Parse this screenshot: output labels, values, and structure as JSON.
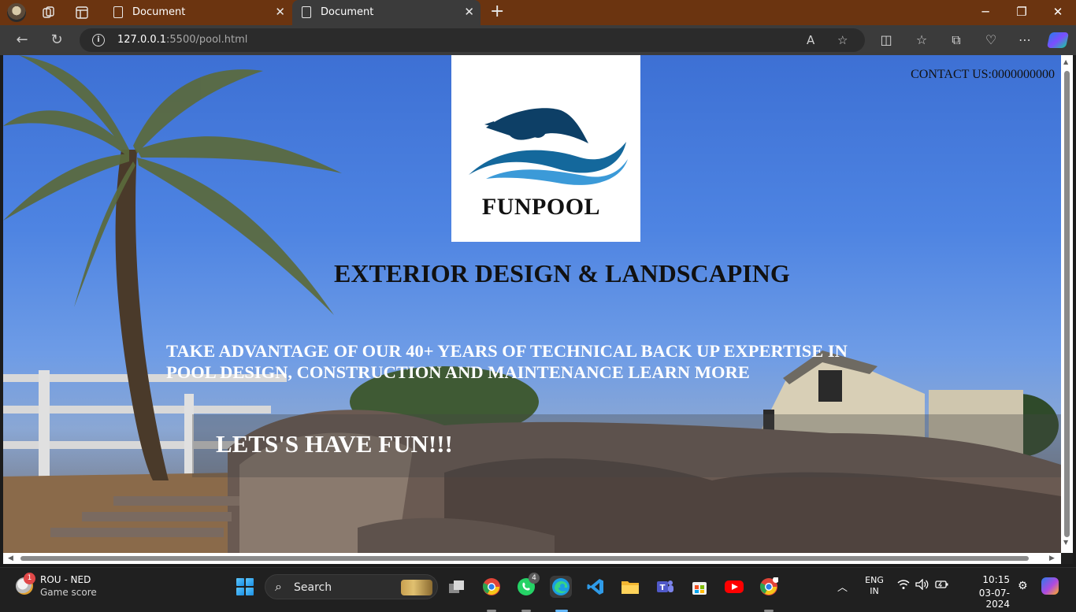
{
  "browser": {
    "tabs": [
      {
        "title": "Document",
        "active": false
      },
      {
        "title": "Document",
        "active": true
      }
    ],
    "url_host": "127.0.0.1",
    "url_rest": ":5500/pool.html",
    "colors": {
      "titlebar": "#6b3410",
      "toolbar": "#3b3b3b"
    }
  },
  "page": {
    "logo_text": "FUNPOOL",
    "contact": "CONTACT US:0000000000",
    "heading": "EXTERIOR DESIGN & LANDSCAPING",
    "tagline_line1": "TAKE ADVANTAGE OF OUR 40+ YEARS OF TECHNICAL BACK UP EXPERTISE IN",
    "tagline_line2": "POOL DESIGN, CONSTRUCTION AND MAINTENANCE LEARN MORE",
    "fun_text": "LETS'S HAVE FUN!!!"
  },
  "taskbar": {
    "widget_badge": "1",
    "widget_title": "ROU - NED",
    "widget_subtitle": "Game score",
    "search_placeholder": "Search",
    "whatsapp_badge": "4",
    "lang_line1": "ENG",
    "lang_line2": "IN",
    "time": "10:15",
    "date": "03-07-2024"
  }
}
